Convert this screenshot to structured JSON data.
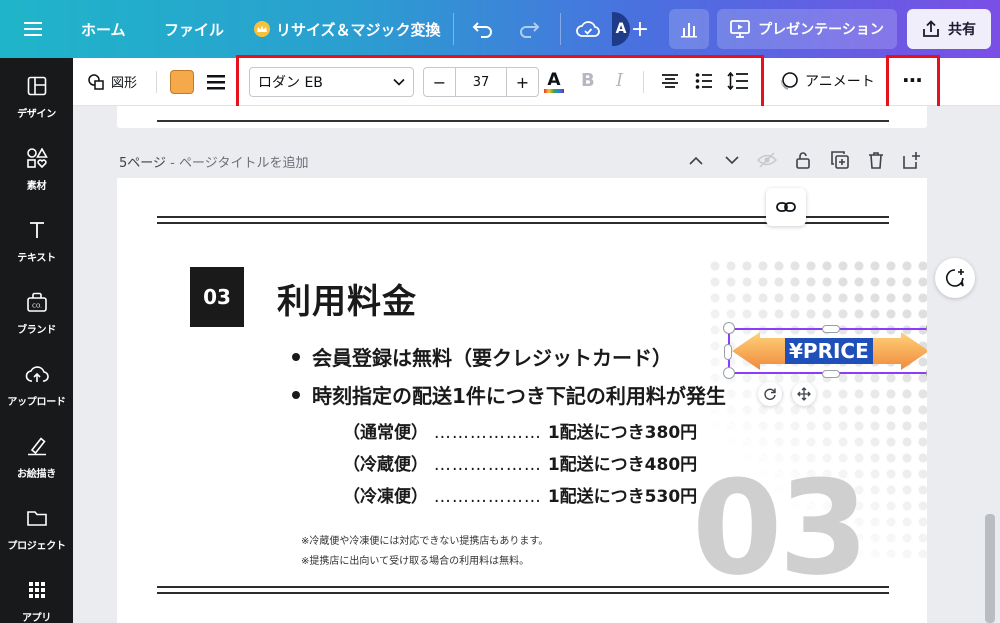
{
  "topbar": {
    "home": "ホーム",
    "file": "ファイル",
    "resize": "リサイズ＆マジック変換",
    "avatar_initial": "A",
    "present": "プレゼンテーション",
    "share": "共有"
  },
  "sidebar": {
    "items": [
      {
        "label": "デザイン",
        "icon": "layout-icon"
      },
      {
        "label": "素材",
        "icon": "elements-icon"
      },
      {
        "label": "テキスト",
        "icon": "text-icon"
      },
      {
        "label": "ブランド",
        "icon": "brand-icon"
      },
      {
        "label": "アップロード",
        "icon": "cloud-upload-icon"
      },
      {
        "label": "お絵描き",
        "icon": "draw-icon"
      },
      {
        "label": "プロジェクト",
        "icon": "folder-icon"
      },
      {
        "label": "アプリ",
        "icon": "apps-grid-icon"
      }
    ]
  },
  "toolbar": {
    "shape_label": "図形",
    "fill_color": "#f5a94a",
    "font_name": "ロダン EB",
    "font_size": "37",
    "minus": "−",
    "plus": "+",
    "text_color_glyph": "A",
    "bold_glyph": "B",
    "italic_glyph": "I",
    "animate": "アニメート",
    "more": "···"
  },
  "page": {
    "number_label": "5ページ",
    "title_placeholder": "ページタイトルを追加",
    "section_number": "03",
    "title": "利用料金",
    "bullets": [
      "会員登録は無料（要クレジットカード）",
      "時刻指定の配送1件につき下記の利用料が発生"
    ],
    "rates": [
      {
        "type": "（通常便）",
        "dots": "………………",
        "price": "1配送につき380円"
      },
      {
        "type": "（冷蔵便）",
        "dots": "………………",
        "price": "1配送につき480円"
      },
      {
        "type": "（冷凍便）",
        "dots": "………………",
        "price": "1配送につき530円"
      }
    ],
    "notes": [
      "※冷蔵便や冷凍便には対応できない提携店もあります。",
      "※提携店に出向いて受け取る場合の利用料は無料。"
    ],
    "big_number": "03",
    "price_label": "¥PRICE"
  },
  "colors": {
    "selection": "#8b3dff",
    "highlight": "#e6121b",
    "arrow_gradient_start": "#ffc768",
    "arrow_gradient_end": "#f08a3c"
  }
}
